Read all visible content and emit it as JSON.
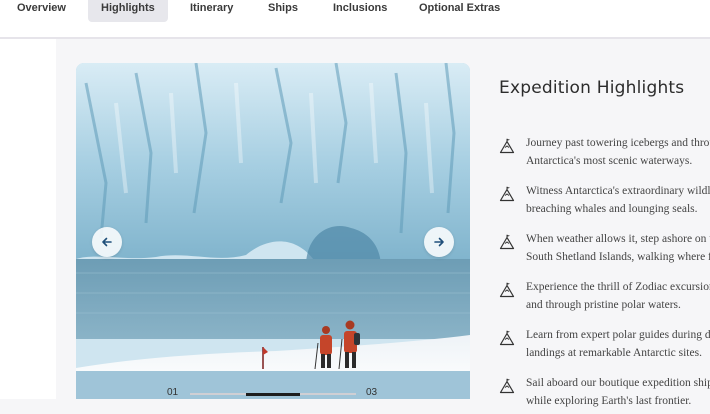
{
  "tabs": [
    {
      "label": "Overview"
    },
    {
      "label": "Highlights"
    },
    {
      "label": "Itinerary"
    },
    {
      "label": "Ships"
    },
    {
      "label": "Inclusions"
    },
    {
      "label": "Optional Extras"
    }
  ],
  "active_tab": "Highlights",
  "carousel": {
    "current": "01",
    "total": "03",
    "progress": 0.33,
    "prev_icon": "arrow-left-icon",
    "next_icon": "arrow-right-icon"
  },
  "highlights": {
    "title": "Expedition Highlights",
    "icon": "mountain-flag-icon",
    "items": [
      {
        "line1": "Journey past towering icebergs and throug",
        "line2": "Antarctica's most scenic waterways."
      },
      {
        "line1": "Witness Antarctica's extraordinary wildlif",
        "line2": "breaching whales and lounging seals."
      },
      {
        "line1": "When weather allows it, step ashore on th",
        "line2": "South Shetland Islands, walking where fev"
      },
      {
        "line1": "Experience the thrill of Zodiac excursions",
        "line2": "and through pristine polar waters."
      },
      {
        "line1": "Learn from expert polar guides during dai",
        "line2": "landings at remarkable Antarctic sites."
      },
      {
        "line1": "Sail aboard our boutique expedition ship,",
        "line2": "while exploring Earth's last frontier."
      }
    ]
  },
  "colors": {
    "accent": "#1f4f7a",
    "tab_active_bg": "#e7e7ec",
    "glacier": "#a9d0e2",
    "snow": "#f4f7fa",
    "parka": "#c5452a"
  }
}
